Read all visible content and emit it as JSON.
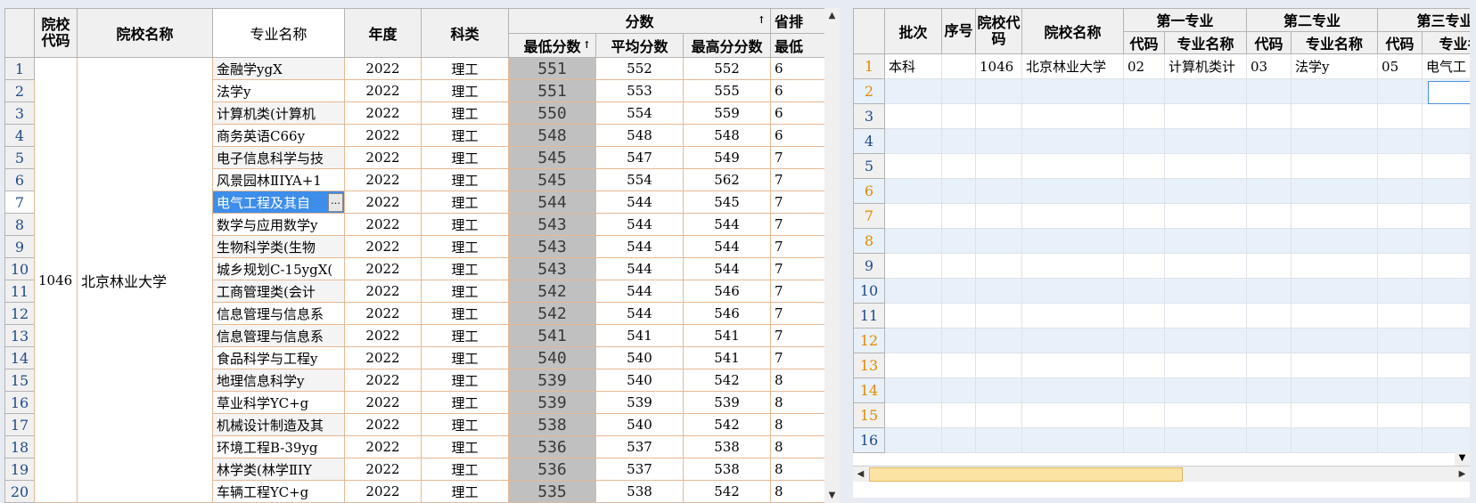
{
  "left": {
    "headers": {
      "school_code": "院校代码",
      "school_name": "院校名称",
      "major_name": "专业名称",
      "year": "年度",
      "category": "科类",
      "score_group": "分数",
      "min_score": "最低分数",
      "avg_score": "平均分数",
      "max_score": "最高分分数",
      "rank_group": "省排",
      "rank_min": "最低"
    },
    "sort_arrow": "↑",
    "merged": {
      "school_code": "1046",
      "school_name": "北京林业大学"
    },
    "rows": [
      {
        "n": "1",
        "major": "金融学ygX",
        "year": "2022",
        "cat": "理工",
        "min": "551",
        "avg": "552",
        "max": "552",
        "rank": "6"
      },
      {
        "n": "2",
        "major": "法学y",
        "year": "2022",
        "cat": "理工",
        "min": "551",
        "avg": "553",
        "max": "555",
        "rank": "6"
      },
      {
        "n": "3",
        "major": "计算机类(计算机",
        "year": "2022",
        "cat": "理工",
        "min": "550",
        "avg": "554",
        "max": "559",
        "rank": "6"
      },
      {
        "n": "4",
        "major": "商务英语C66y",
        "year": "2022",
        "cat": "理工",
        "min": "548",
        "avg": "548",
        "max": "548",
        "rank": "6"
      },
      {
        "n": "5",
        "major": "电子信息科学与技",
        "year": "2022",
        "cat": "理工",
        "min": "545",
        "avg": "547",
        "max": "549",
        "rank": "7"
      },
      {
        "n": "6",
        "major": "风景园林ⅡⅠYA+1",
        "year": "2022",
        "cat": "理工",
        "min": "545",
        "avg": "554",
        "max": "562",
        "rank": "7"
      },
      {
        "n": "7",
        "major": "电气工程及其自",
        "year": "2022",
        "cat": "理工",
        "min": "544",
        "avg": "544",
        "max": "545",
        "rank": "7"
      },
      {
        "n": "8",
        "major": "数学与应用数学y",
        "year": "2022",
        "cat": "理工",
        "min": "543",
        "avg": "544",
        "max": "544",
        "rank": "7"
      },
      {
        "n": "9",
        "major": "生物科学类(生物",
        "year": "2022",
        "cat": "理工",
        "min": "543",
        "avg": "544",
        "max": "544",
        "rank": "7"
      },
      {
        "n": "10",
        "major": "城乡规划C-15ygX(",
        "year": "2022",
        "cat": "理工",
        "min": "543",
        "avg": "544",
        "max": "544",
        "rank": "7"
      },
      {
        "n": "11",
        "major": "工商管理类(会计",
        "year": "2022",
        "cat": "理工",
        "min": "542",
        "avg": "544",
        "max": "546",
        "rank": "7"
      },
      {
        "n": "12",
        "major": "信息管理与信息系",
        "year": "2022",
        "cat": "理工",
        "min": "542",
        "avg": "544",
        "max": "546",
        "rank": "7"
      },
      {
        "n": "13",
        "major": "信息管理与信息系",
        "year": "2022",
        "cat": "理工",
        "min": "541",
        "avg": "541",
        "max": "541",
        "rank": "7"
      },
      {
        "n": "14",
        "major": "食品科学与工程y",
        "year": "2022",
        "cat": "理工",
        "min": "540",
        "avg": "540",
        "max": "541",
        "rank": "7"
      },
      {
        "n": "15",
        "major": "地理信息科学y",
        "year": "2022",
        "cat": "理工",
        "min": "539",
        "avg": "540",
        "max": "542",
        "rank": "8"
      },
      {
        "n": "16",
        "major": "草业科学YC+g",
        "year": "2022",
        "cat": "理工",
        "min": "539",
        "avg": "539",
        "max": "539",
        "rank": "8"
      },
      {
        "n": "17",
        "major": "机械设计制造及其",
        "year": "2022",
        "cat": "理工",
        "min": "538",
        "avg": "540",
        "max": "542",
        "rank": "8"
      },
      {
        "n": "18",
        "major": "环境工程B-39yg",
        "year": "2022",
        "cat": "理工",
        "min": "536",
        "avg": "537",
        "max": "538",
        "rank": "8"
      },
      {
        "n": "19",
        "major": "林学类(林学ⅡⅠY",
        "year": "2022",
        "cat": "理工",
        "min": "536",
        "avg": "537",
        "max": "538",
        "rank": "8"
      },
      {
        "n": "20",
        "major": "车辆工程YC+g",
        "year": "2022",
        "cat": "理工",
        "min": "535",
        "avg": "538",
        "max": "542",
        "rank": "8"
      }
    ],
    "cell_button": "…"
  },
  "right": {
    "headers": {
      "batch": "批次",
      "seq": "序号",
      "school_code": "院校代码",
      "school_name": "院校名称",
      "first_major": "第一专业",
      "second_major": "第二专业",
      "third_major": "第三专业",
      "code": "代码",
      "major_name": "专业名称"
    },
    "rows": [
      {
        "n": "1",
        "batch": "本科",
        "seq": "",
        "school_code": "1046",
        "school_name": "北京林业大学",
        "c1": "02",
        "m1": "计算机类计",
        "c2": "03",
        "m2": "法学y",
        "c3": "05",
        "m3": "电气工"
      },
      {
        "n": "2"
      },
      {
        "n": "3"
      },
      {
        "n": "4"
      },
      {
        "n": "5"
      },
      {
        "n": "6"
      },
      {
        "n": "7"
      },
      {
        "n": "8"
      },
      {
        "n": "9"
      },
      {
        "n": "10"
      },
      {
        "n": "11"
      },
      {
        "n": "12"
      },
      {
        "n": "13"
      },
      {
        "n": "14"
      },
      {
        "n": "15"
      },
      {
        "n": "16"
      }
    ]
  },
  "scroll": {
    "up_arrow": "▲",
    "down_arrow": "▼",
    "left_arrow": "◀",
    "right_arrow": "▶"
  }
}
